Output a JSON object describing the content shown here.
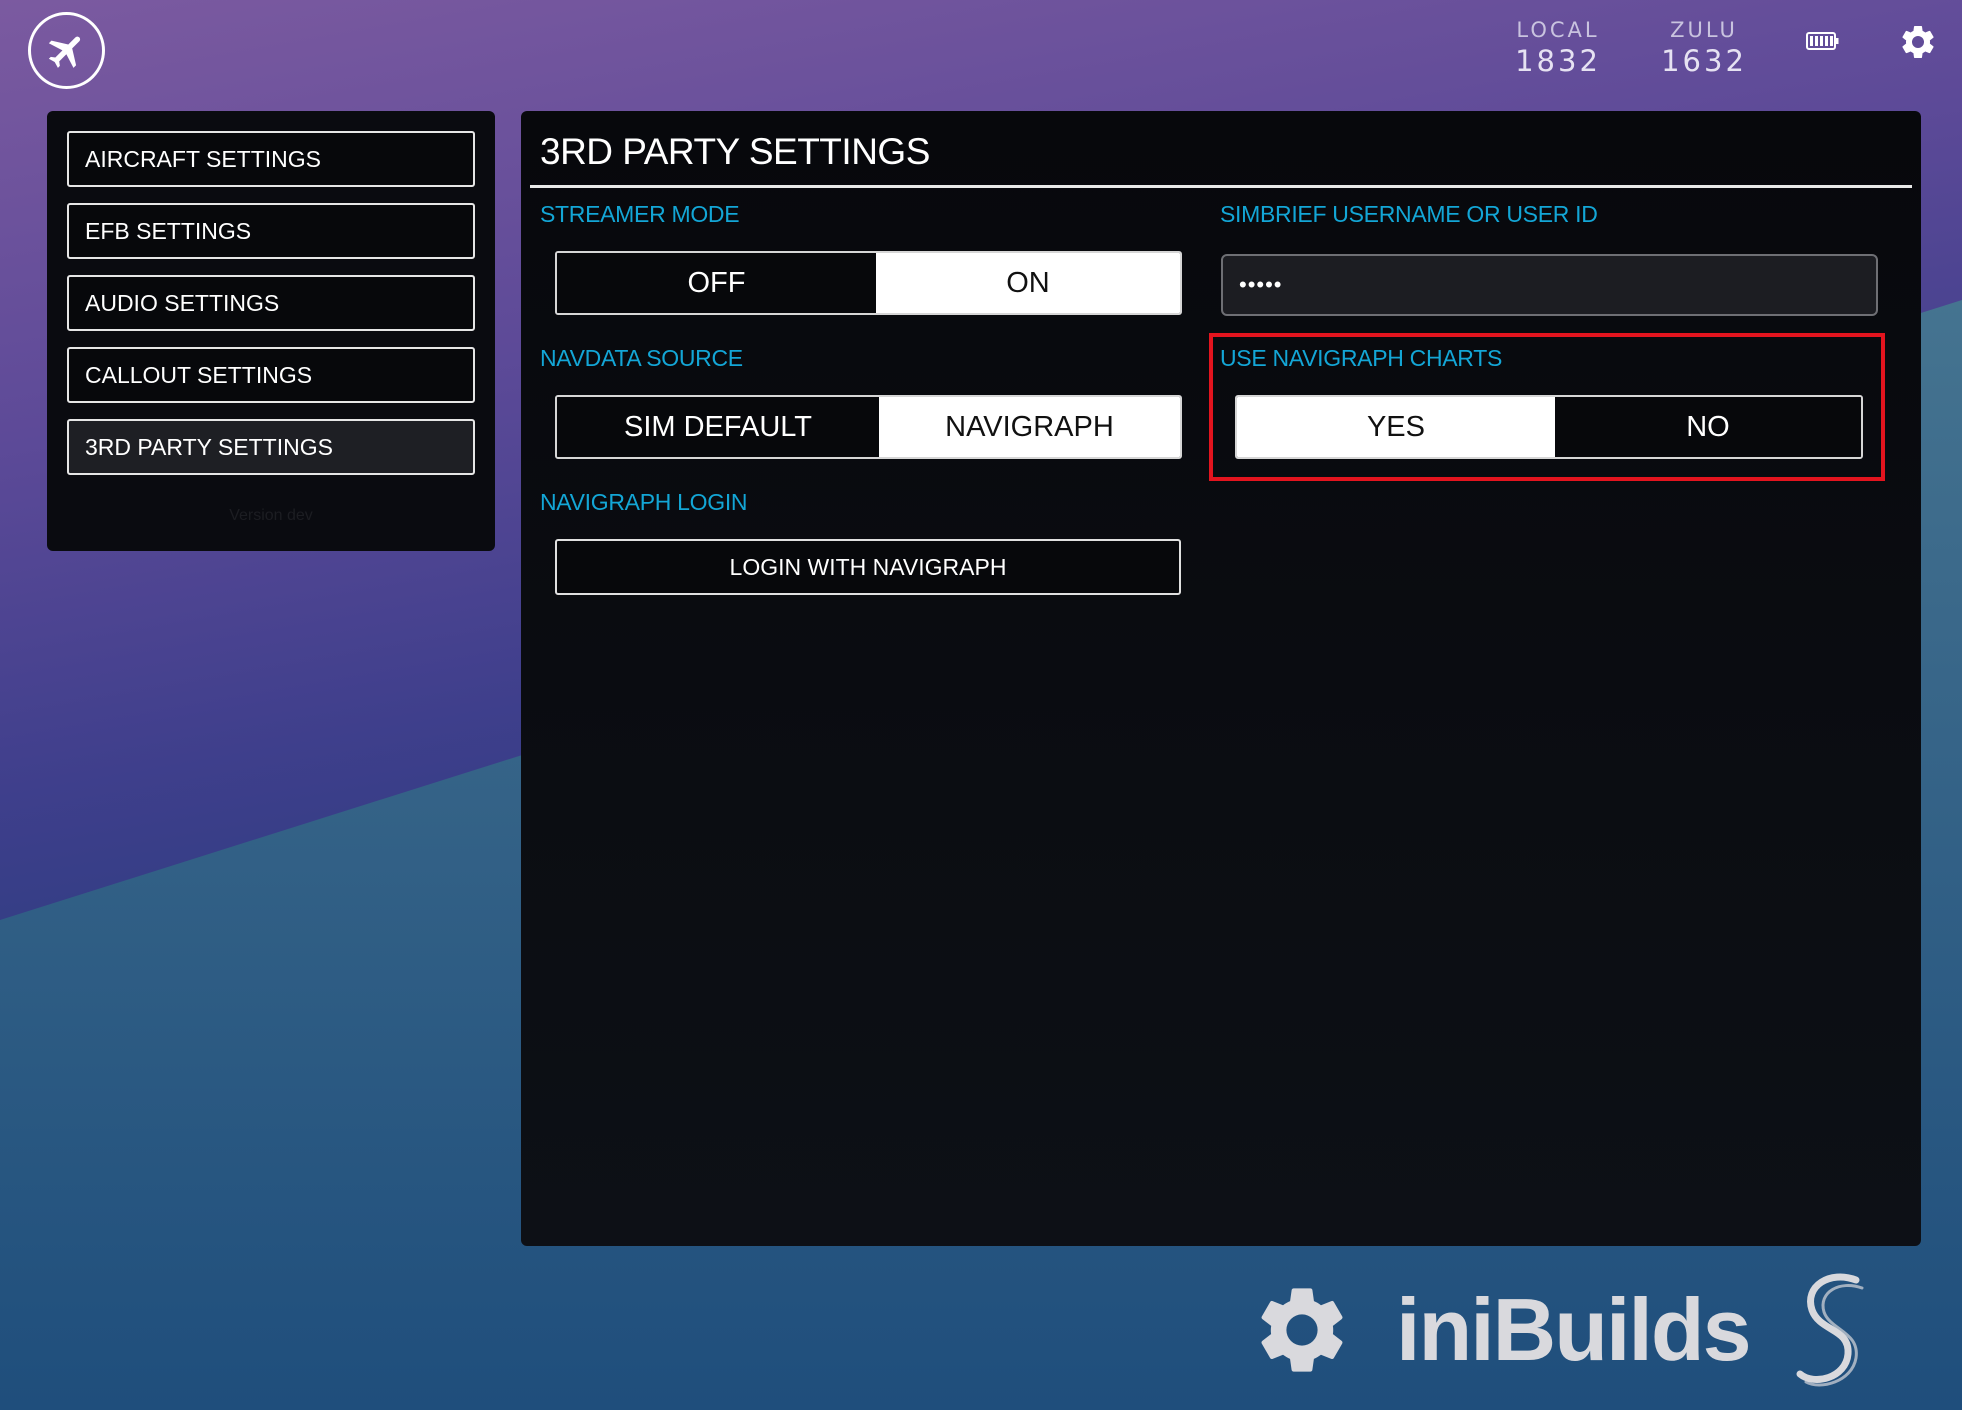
{
  "topbar": {
    "home_icon": "airplane-icon",
    "local_label": "LOCAL",
    "local_time": "1832",
    "zulu_label": "ZULU",
    "zulu_time": "1632",
    "battery_icon": "battery-icon",
    "settings_icon": "gear-icon"
  },
  "sidebar": {
    "items": [
      {
        "label": "AIRCRAFT SETTINGS",
        "active": false
      },
      {
        "label": "EFB SETTINGS",
        "active": false
      },
      {
        "label": "AUDIO SETTINGS",
        "active": false
      },
      {
        "label": "CALLOUT SETTINGS",
        "active": false
      },
      {
        "label": "3RD PARTY SETTINGS",
        "active": true
      }
    ],
    "version": "Version dev"
  },
  "panel": {
    "title": "3RD PARTY SETTINGS",
    "streamer_mode": {
      "label": "STREAMER MODE",
      "options": [
        "OFF",
        "ON"
      ],
      "selected": "ON"
    },
    "simbrief": {
      "label": "SIMBRIEF USERNAME OR USER ID",
      "value": "•••••"
    },
    "navdata_source": {
      "label": "NAVDATA SOURCE",
      "options": [
        "SIM DEFAULT",
        "NAVIGRAPH"
      ],
      "selected": "NAVIGRAPH"
    },
    "navigraph_charts": {
      "label": "USE NAVIGRAPH CHARTS",
      "options": [
        "YES",
        "NO"
      ],
      "selected": "YES"
    },
    "navigraph_login": {
      "label": "NAVIGRAPH LOGIN",
      "button": "LOGIN WITH NAVIGRAPH"
    }
  },
  "brand": {
    "name": "iniBuilds",
    "icons": [
      "gear-icon",
      "s-logo-icon"
    ]
  },
  "colors": {
    "accent": "#13a6d6",
    "highlight": "#e3141e",
    "panel": "#07080c"
  }
}
